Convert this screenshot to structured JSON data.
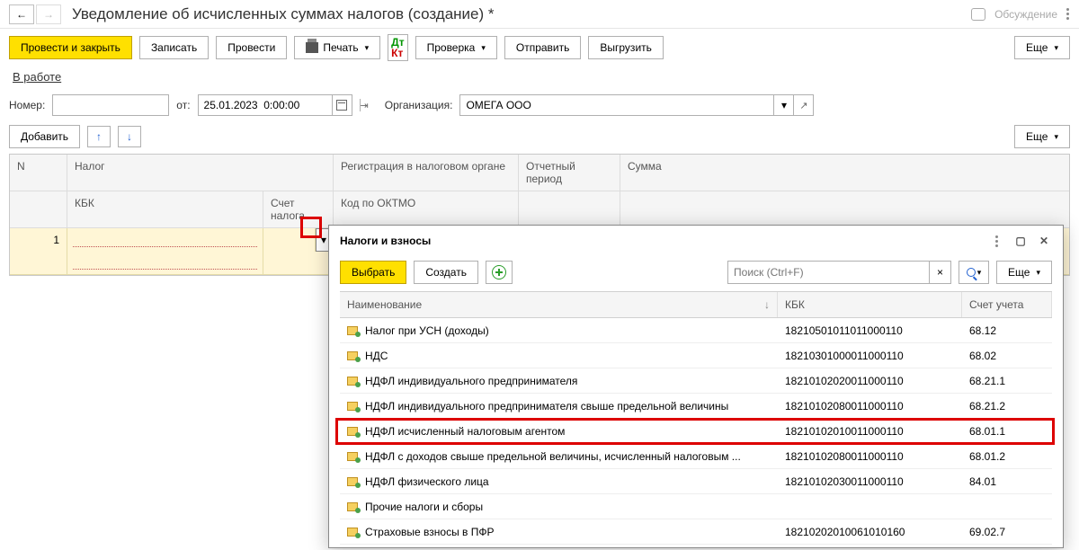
{
  "title": "Уведомление об исчисленных суммах налогов (создание) *",
  "discussion": "Обсуждение",
  "toolbar": {
    "post_close": "Провести и закрыть",
    "write": "Записать",
    "post": "Провести",
    "print": "Печать",
    "check": "Проверка",
    "send": "Отправить",
    "export": "Выгрузить",
    "more": "Еще"
  },
  "status": "В работе",
  "form": {
    "number_label": "Номер:",
    "number_value": "",
    "from_label": "от:",
    "date_value": "25.01.2023  0:00:00",
    "org_label": "Организация:",
    "org_value": "ОМЕГА ООО"
  },
  "grid_toolbar": {
    "add": "Добавить",
    "more": "Еще"
  },
  "grid": {
    "h_n": "N",
    "h_tax": "Налог",
    "h_kbk": "КБК",
    "h_acc": "Счет налога",
    "h_reg": "Регистрация в налоговом органе",
    "h_oktmo": "Код по ОКТМО",
    "h_period": "Отчетный период",
    "h_sum": "Сумма",
    "row_n": "1"
  },
  "popup": {
    "title": "Налоги и взносы",
    "select": "Выбрать",
    "create": "Создать",
    "search_placeholder": "Поиск (Ctrl+F)",
    "more": "Еще",
    "h_name": "Наименование",
    "h_kbk": "КБК",
    "h_acc": "Счет учета",
    "rows": [
      {
        "name": "Налог при УСН (доходы)",
        "kbk": "18210501011011000110",
        "acc": "68.12"
      },
      {
        "name": "НДС",
        "kbk": "18210301000011000110",
        "acc": "68.02"
      },
      {
        "name": "НДФЛ индивидуального предпринимателя",
        "kbk": "18210102020011000110",
        "acc": "68.21.1"
      },
      {
        "name": "НДФЛ индивидуального предпринимателя свыше предельной величины",
        "kbk": "18210102080011000110",
        "acc": "68.21.2"
      },
      {
        "name": "НДФЛ исчисленный налоговым агентом",
        "kbk": "18210102010011000110",
        "acc": "68.01.1"
      },
      {
        "name": "НДФЛ с доходов свыше предельной величины, исчисленный налоговым ...",
        "kbk": "18210102080011000110",
        "acc": "68.01.2"
      },
      {
        "name": "НДФЛ физического лица",
        "kbk": "18210102030011000110",
        "acc": "84.01"
      },
      {
        "name": "Прочие налоги и сборы",
        "kbk": "",
        "acc": ""
      },
      {
        "name": "Страховые взносы в ПФР",
        "kbk": "18210202010061010160",
        "acc": "69.02.7"
      }
    ]
  }
}
